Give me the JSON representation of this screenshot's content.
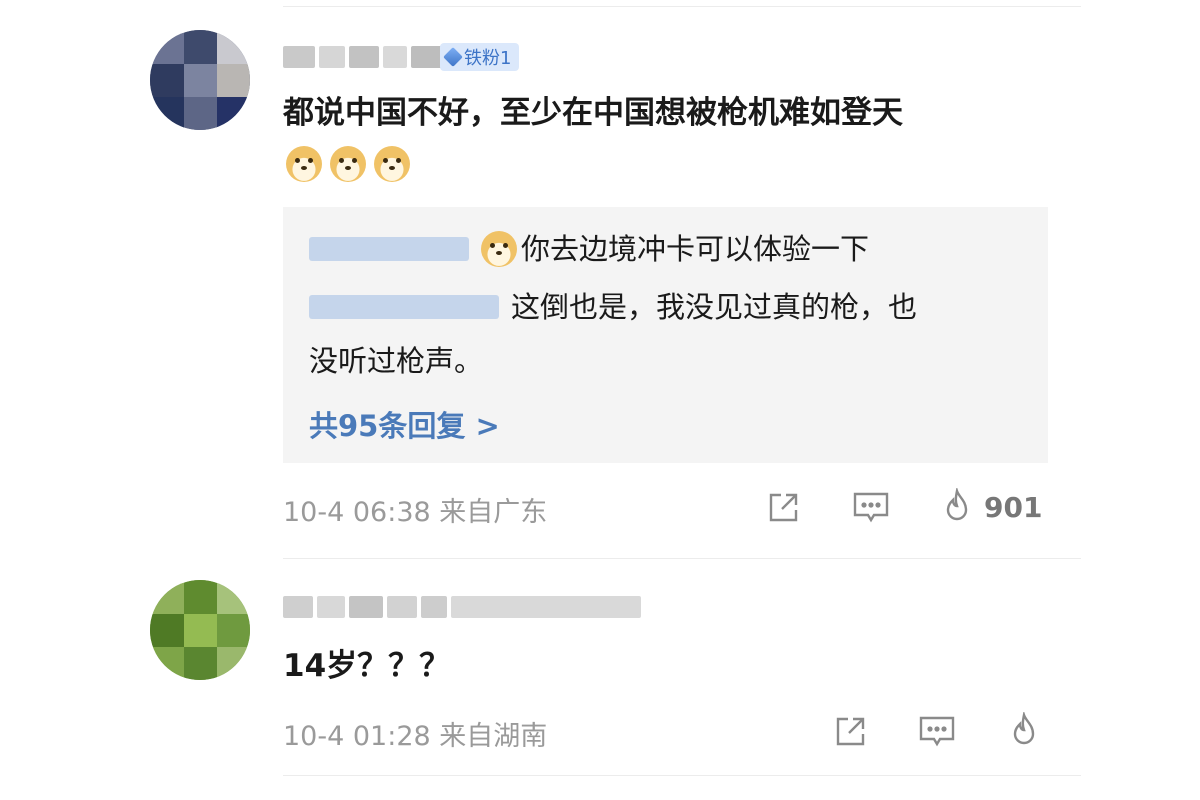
{
  "comments": [
    {
      "badge": "铁粉1",
      "text": "都说中国不好，至少在中国想被枪机难如登天",
      "replies": [
        {
          "text": "你去边境冲卡可以体验一下"
        },
        {
          "text": "这倒也是，我没见过真的枪，也"
        },
        {
          "text": "没听过枪声。"
        }
      ],
      "more_replies": "共95条回复 >",
      "timestamp": "10-4 06:38 来自广东",
      "likes": "901",
      "icons": {
        "share": "share-icon",
        "comment": "comment-icon",
        "like": "fire-like-icon"
      }
    },
    {
      "text": "14岁？？？",
      "timestamp": "10-4 01:28 来自湖南",
      "icons": {
        "share": "share-icon",
        "comment": "comment-icon",
        "like": "fire-like-icon"
      }
    }
  ],
  "colors": {
    "link": "#4a7ab9",
    "badge_bg": "#dbe8fb",
    "badge_text": "#3d74c7",
    "reply_bg": "#f4f4f4"
  }
}
